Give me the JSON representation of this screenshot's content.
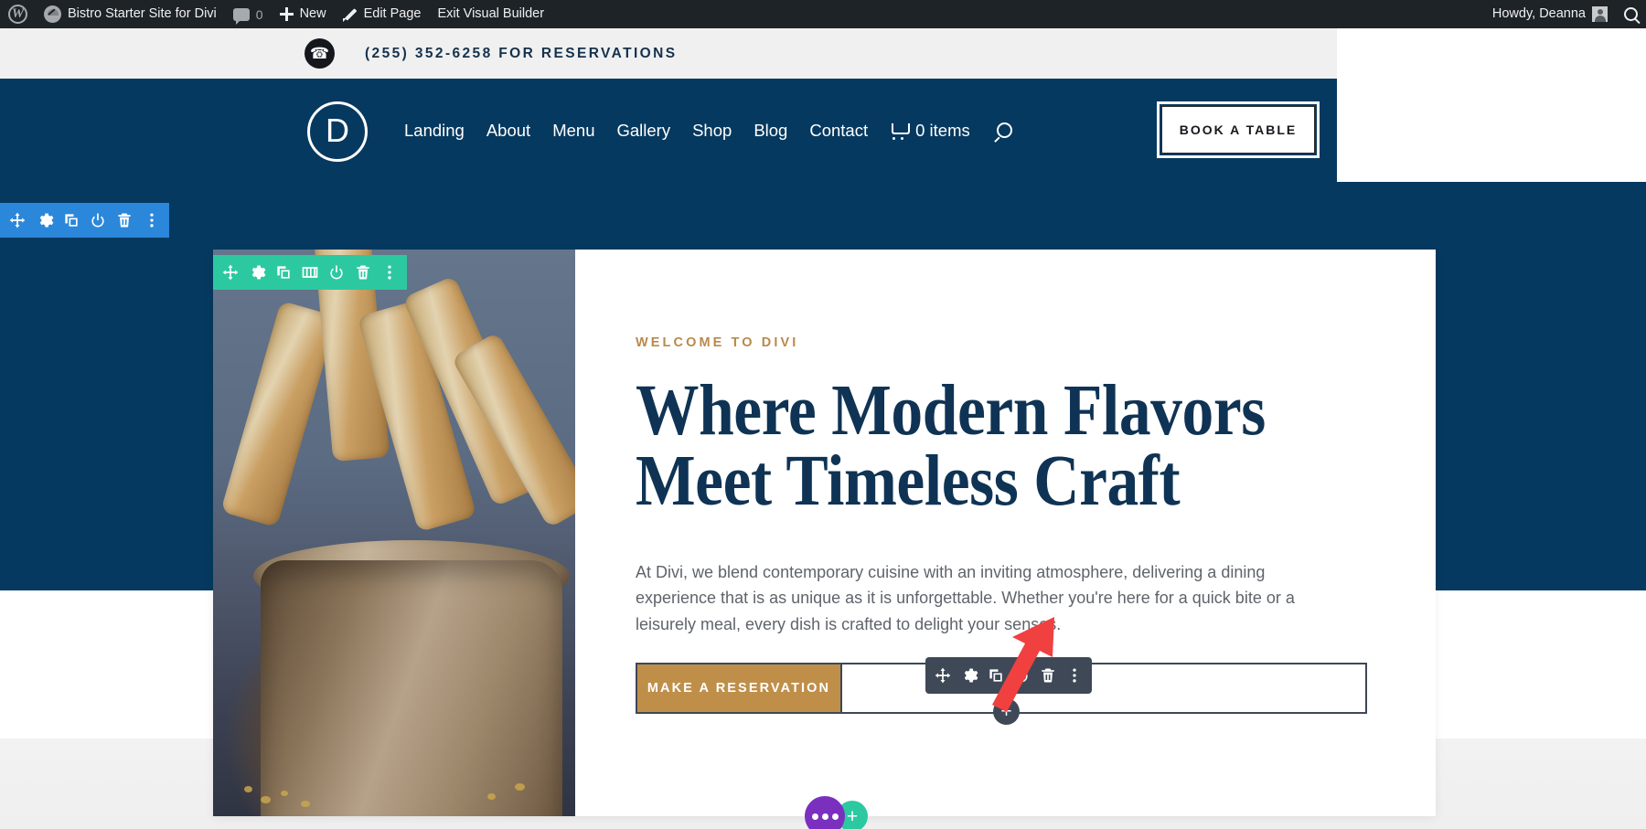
{
  "admin_bar": {
    "wp_logo_icon": "wordpress-logo-icon",
    "site_icon": "dashboard-icon",
    "site_name": "Bistro Starter Site for Divi",
    "comments_icon": "comment-bubble-icon",
    "comments_count": "0",
    "new_icon": "plus-icon",
    "new_label": "New",
    "edit_icon": "pencil-icon",
    "edit_label": "Edit Page",
    "exit_label": "Exit Visual Builder",
    "howdy_label": "Howdy, Deanna",
    "avatar_icon": "user-avatar-icon",
    "search_icon": "search-icon"
  },
  "info_bar": {
    "phone_icon": "phone-icon",
    "phone_glyph": "☎",
    "text": "(255) 352-6258 FOR RESERVATIONS"
  },
  "header": {
    "logo_letter": "D",
    "nav": [
      {
        "label": "Landing"
      },
      {
        "label": "About"
      },
      {
        "label": "Menu"
      },
      {
        "label": "Gallery"
      },
      {
        "label": "Shop"
      },
      {
        "label": "Blog"
      },
      {
        "label": "Contact"
      }
    ],
    "cart_icon": "shopping-cart-icon",
    "cart_label": "0 items",
    "search_icon": "search-icon",
    "cta_label": "BOOK A TABLE"
  },
  "hero": {
    "eyebrow": "WELCOME TO DIVI",
    "title": "Where Modern Flavors\nMeet Timeless Craft",
    "paragraph": "At Divi, we blend contemporary cuisine with an inviting atmosphere, delivering a dining experience that is as unique as it is unforgettable. Whether you're here for a quick bite or a leisurely meal, every dish is crafted to delight your senses.",
    "button_label": "MAKE A RESERVATION",
    "photo_alt": "seeded breadsticks in a paper bag"
  },
  "section_toolbar": {
    "label": "section-settings-toolbar",
    "icons": [
      "move-icon",
      "gear-icon",
      "duplicate-icon",
      "power-icon",
      "trash-icon",
      "more-options-icon"
    ]
  },
  "row_toolbar": {
    "label": "row-settings-toolbar",
    "icons": [
      "move-icon",
      "gear-icon",
      "duplicate-icon",
      "columns-icon",
      "power-icon",
      "trash-icon",
      "more-options-icon"
    ]
  },
  "module_toolbar": {
    "label": "module-settings-toolbar",
    "icons": [
      "move-icon",
      "gear-icon",
      "duplicate-icon",
      "power-icon",
      "trash-icon",
      "more-options-icon"
    ]
  },
  "add_module_button": {
    "glyph": "+"
  },
  "fab": {
    "menu_icon": "ellipsis-icon",
    "add_glyph": "+"
  },
  "annotation": {
    "arrow_icon": "red-arrow-icon",
    "arrow_color": "#f04040"
  },
  "colors": {
    "admin_bar_bg": "#1d2327",
    "brand_navy": "#06395f",
    "title_navy": "#0f3354",
    "gold": "#bf8f4a",
    "eyebrow_gold": "#b98a4b",
    "section_blue": "#2b87da",
    "row_green": "#2cc9a0",
    "module_dark": "#3e4856",
    "fab_purple": "#7b2fbe",
    "info_bar_bg": "#f0f0f0"
  }
}
